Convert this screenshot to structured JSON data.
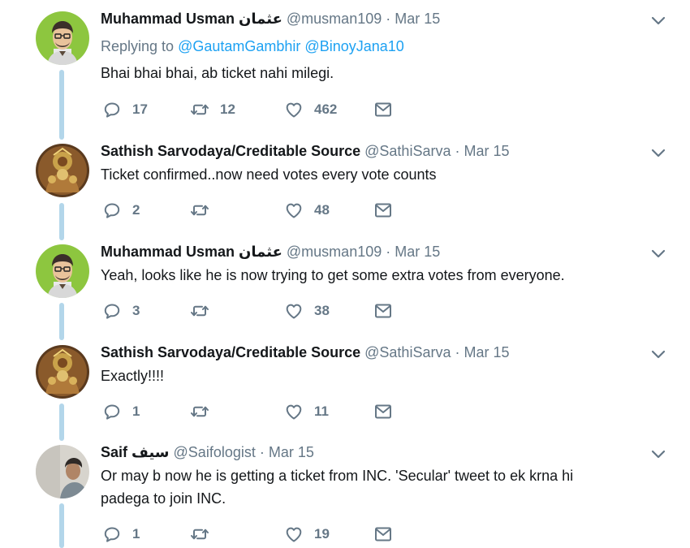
{
  "tweets": [
    {
      "name": "Muhammad Usman عثمان",
      "handle": "@musman109",
      "date": "Mar 15",
      "replying_label": "Replying to",
      "replying_to": [
        "@GautamGambhir",
        "@BinoyJana10"
      ],
      "text": "Bhai bhai bhai, ab ticket nahi milegi.",
      "replies": "17",
      "retweets": "12",
      "likes": "462",
      "avatar": "cartoon-man-avatar"
    },
    {
      "name": "Sathish Sarvodaya/Creditable Source",
      "handle": "@SathiSarva",
      "date": "Mar 15",
      "text": "Ticket confirmed..now need votes every vote counts",
      "replies": "2",
      "retweets": "",
      "likes": "48",
      "avatar": "deity-avatar"
    },
    {
      "name": "Muhammad Usman عثمان",
      "handle": "@musman109",
      "date": "Mar 15",
      "text": "Yeah, looks like he is now trying to get some extra votes from everyone.",
      "replies": "3",
      "retweets": "",
      "likes": "38",
      "avatar": "cartoon-man-avatar"
    },
    {
      "name": "Sathish Sarvodaya/Creditable Source",
      "handle": "@SathiSarva",
      "date": "Mar 15",
      "text": "Exactly!!!!",
      "replies": "1",
      "retweets": "",
      "likes": "11",
      "avatar": "deity-avatar"
    },
    {
      "name": "Saif سیف",
      "handle": "@Saifologist",
      "date": "Mar 15",
      "text": "Or may b now he is getting a ticket from INC. 'Secular' tweet to ek krna hi padega to join INC.",
      "replies": "1",
      "retweets": "",
      "likes": "19",
      "avatar": "photo-man-avatar"
    }
  ],
  "separator": "·",
  "colors": {
    "name": "#14171a",
    "secondary": "#657786",
    "link": "#1da1f2",
    "thread_line": "#b3d6ea"
  }
}
